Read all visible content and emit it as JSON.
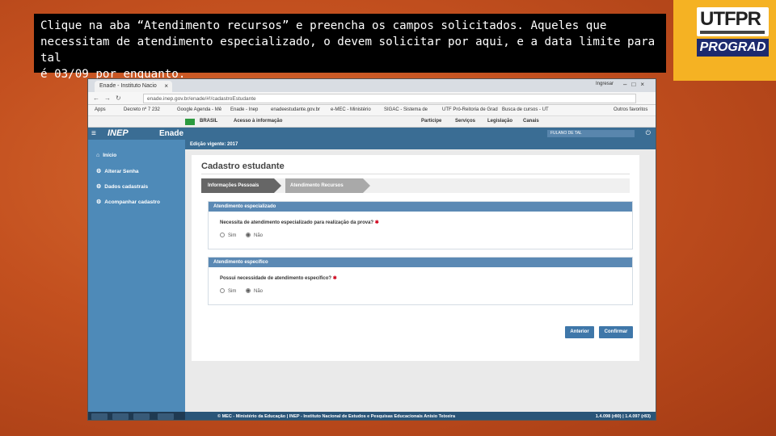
{
  "slide": {
    "caption_line1": "Clique na aba “Atendimento recursos” e preencha os campos solicitados. Aqueles que",
    "caption_line2": "necessitam de atendimento especializado, o devem solicitar por aqui, e a data limite para tal",
    "caption_line3": "é 03/09 por enquanto.",
    "logo_text": "UTFPR",
    "logo_subtitle": "PROGRAD"
  },
  "browser": {
    "tab_title": "Enade - Instituto Nacio",
    "user_label": "Ingresar",
    "url": "enade.inep.gov.br/enade/#!/cadastroEstudante",
    "bookmarks": [
      "Apps",
      "Decreto nº 7 232",
      "Google Agenda - Mê",
      "Enade - Inep",
      "enadeestudante.gov.br",
      "e-MEC - Ministério",
      "SIGAC - Sistema de",
      "UTF Pró-Reitoria de Grad",
      "Busca de cursos - UT",
      "Outros favoritos"
    ],
    "gov_bar": {
      "brasil": "BRASIL",
      "access": "Acesso à informação",
      "links": [
        "Participe",
        "Serviços",
        "Legislação",
        "Canais"
      ]
    }
  },
  "app": {
    "logo": "INEP",
    "product": "Enade",
    "user_name": "FULANO DE TAL",
    "edition": "Edição vigente: 2017",
    "sidebar": [
      {
        "icon": "home-icon",
        "label": "Início"
      },
      {
        "icon": "gear-icon",
        "label": "Alterar Senha"
      },
      {
        "icon": "gear-icon",
        "label": "Dados cadastrais"
      },
      {
        "icon": "gear-icon",
        "label": "Acompanhar cadastro"
      }
    ],
    "page_title": "Cadastro estudante",
    "steps": [
      "Informações Pessoais",
      "Atendimento Recursos"
    ],
    "section1": {
      "title": "Atendimento especializado",
      "question": "Necessita de atendimento especializado para realização da prova?",
      "options": [
        "Sim",
        "Não"
      ],
      "selected": "Não"
    },
    "section2": {
      "title": "Atendimento específico",
      "question": "Possui necessidade de atendimento específico?",
      "options": [
        "Sim",
        "Não"
      ],
      "selected": "Não"
    },
    "buttons": {
      "back": "Anterior",
      "confirm": "Confirmar"
    },
    "footer": "© MEC - Ministério da Educação | INEP - Instituto Nacional de Estudos e Pesquisas Educacionais Anísio Teixeira",
    "footer_versions": "1.4.098 (r80) | 1.4.097 (r83)"
  },
  "colors": {
    "background": "#c3501f",
    "caption_bg": "#000000",
    "logo_bg": "#f5b223",
    "prograd_bg": "#1d2a6e",
    "inep_blue": "#3a6d94",
    "sidebar_blue": "#4e8ab8"
  }
}
